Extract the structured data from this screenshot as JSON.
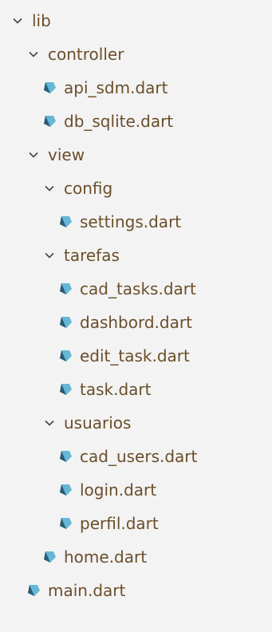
{
  "colors": {
    "background": "#f3f3f3",
    "text": "#6b4e2a",
    "chevron": "#444444",
    "dart_icon_dark": "#2b5b73",
    "dart_icon_light": "#65b7d6"
  },
  "tree": {
    "items": [
      {
        "type": "folder",
        "label": "lib"
      },
      {
        "type": "folder",
        "label": "controller"
      },
      {
        "type": "file",
        "label": "api_sdm.dart"
      },
      {
        "type": "file",
        "label": "db_sqlite.dart"
      },
      {
        "type": "folder",
        "label": "view"
      },
      {
        "type": "folder",
        "label": "config"
      },
      {
        "type": "file",
        "label": "settings.dart"
      },
      {
        "type": "folder",
        "label": "tarefas"
      },
      {
        "type": "file",
        "label": "cad_tasks.dart"
      },
      {
        "type": "file",
        "label": "dashbord.dart"
      },
      {
        "type": "file",
        "label": "edit_task.dart"
      },
      {
        "type": "file",
        "label": "task.dart"
      },
      {
        "type": "folder",
        "label": "usuarios"
      },
      {
        "type": "file",
        "label": "cad_users.dart"
      },
      {
        "type": "file",
        "label": "login.dart"
      },
      {
        "type": "file",
        "label": "perfil.dart"
      },
      {
        "type": "file",
        "label": "home.dart"
      },
      {
        "type": "file",
        "label": "main.dart"
      }
    ]
  }
}
